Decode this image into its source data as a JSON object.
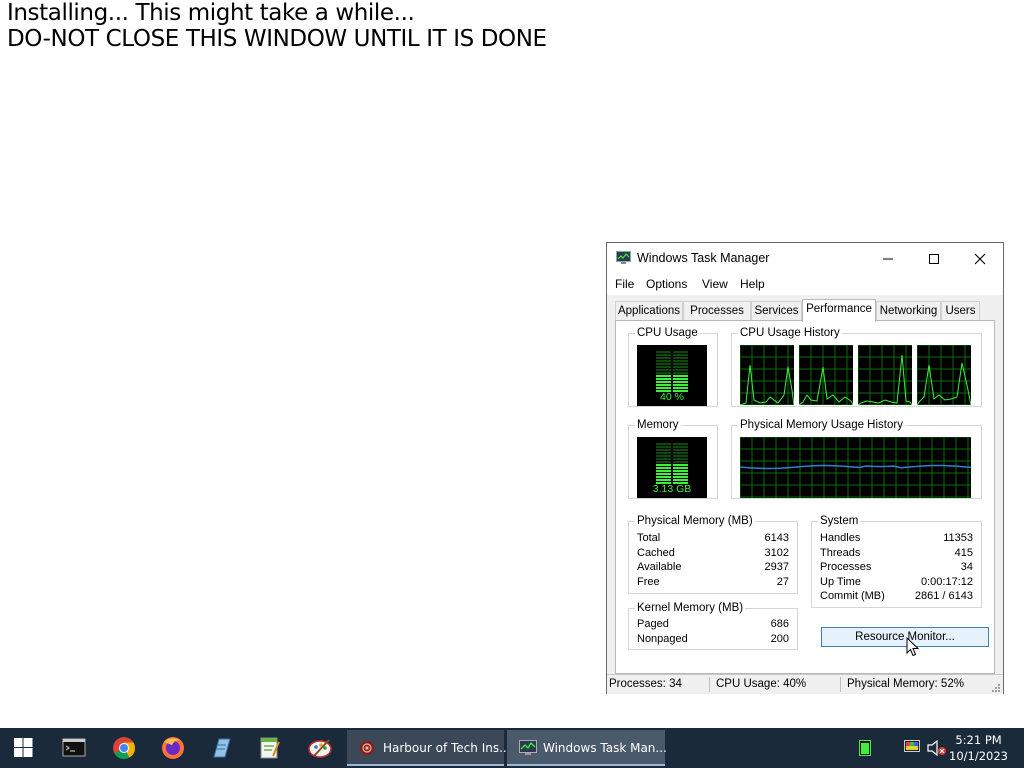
{
  "banner": {
    "line1": "Installing... This might take a while...",
    "line2": "DO-NOT CLOSE THIS WINDOW UNTIL IT IS DONE"
  },
  "taskmgr": {
    "title": "Windows Task Manager",
    "menu": [
      "File",
      "Options",
      "View",
      "Help"
    ],
    "tabs": [
      "Applications",
      "Processes",
      "Services",
      "Performance",
      "Networking",
      "Users"
    ],
    "active_tab": "Performance",
    "cpu_usage": {
      "label": "CPU Usage",
      "value": "40 %",
      "percent": 40
    },
    "cpu_history": {
      "label": "CPU Usage History"
    },
    "memory": {
      "label": "Memory",
      "value": "3.13 GB",
      "percent": 51
    },
    "mem_history": {
      "label": "Physical Memory Usage History"
    },
    "physical_memory": {
      "label": "Physical Memory (MB)",
      "rows": [
        {
          "k": "Total",
          "v": "6143"
        },
        {
          "k": "Cached",
          "v": "3102"
        },
        {
          "k": "Available",
          "v": "2937"
        },
        {
          "k": "Free",
          "v": "27"
        }
      ]
    },
    "kernel_memory": {
      "label": "Kernel Memory (MB)",
      "rows": [
        {
          "k": "Paged",
          "v": "686"
        },
        {
          "k": "Nonpaged",
          "v": "200"
        }
      ]
    },
    "system": {
      "label": "System",
      "rows": [
        {
          "k": "Handles",
          "v": "11353"
        },
        {
          "k": "Threads",
          "v": "415"
        },
        {
          "k": "Processes",
          "v": "34"
        },
        {
          "k": "Up Time",
          "v": "0:00:17:12"
        },
        {
          "k": "Commit (MB)",
          "v": "2861 / 6143"
        }
      ]
    },
    "resource_monitor_label": "Resource Monitor...",
    "status": {
      "processes": "Processes: 34",
      "cpu": "CPU Usage: 40%",
      "memory": "Physical Memory: 52%"
    }
  },
  "taskbar": {
    "apps": [
      {
        "label": "Harbour of Tech Ins..."
      },
      {
        "label": "Windows Task Man..."
      }
    ],
    "clock": {
      "time": "5:21 PM",
      "date": "10/1/2023"
    }
  },
  "colors": {
    "graph_green": "#3cf03c",
    "grid_green": "#0a6b0a",
    "mem_line": "#3a7bd5",
    "taskbar": "#1b2a3a"
  }
}
